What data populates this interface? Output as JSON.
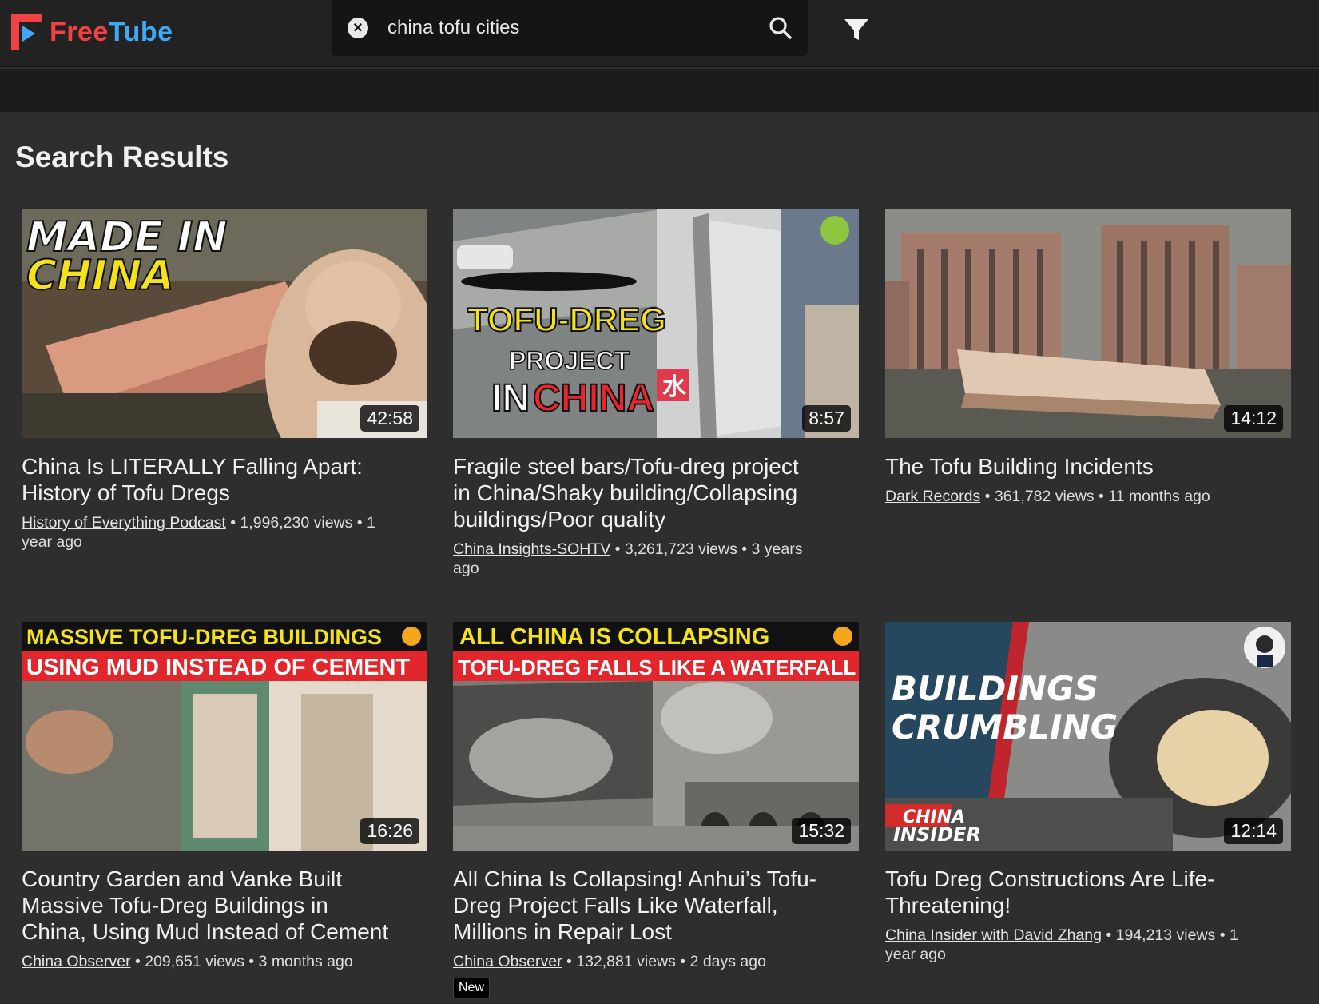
{
  "app": {
    "name_part1": "Free",
    "name_part2": "Tube",
    "brand_red": "#f04242",
    "brand_blue": "#3fa9f5"
  },
  "search": {
    "query": "china tofu cities",
    "clear_icon": "x-circle-icon",
    "search_icon": "magnifier-icon",
    "filter_icon": "funnel-icon"
  },
  "page": {
    "title": "Search Results"
  },
  "results": [
    {
      "title": "China Is LITERALLY Falling Apart: History of Tofu Dregs",
      "channel": "History of Everything Podcast",
      "stats": " • 1,996,230 views • 1 year ago",
      "duration": "42:58",
      "thumb_text": [
        "MADE IN",
        "CHINA"
      ]
    },
    {
      "title": "Fragile steel bars/Tofu-dreg project in China/Shaky building/Collapsing buildings/Poor quality",
      "channel": "China Insights-SOHTV",
      "stats": " • 3,261,723 views • 3 years ago",
      "duration": "8:57",
      "thumb_text": [
        "TOFU-DREG",
        "PROJECT",
        "IN",
        "CHINA",
        "水"
      ]
    },
    {
      "title": "The Tofu Building Incidents",
      "channel": "Dark Records",
      "stats": " • 361,782 views • 11 months ago",
      "duration": "14:12"
    },
    {
      "title": "Country Garden and Vanke Built Massive Tofu-Dreg Buildings in China, Using Mud Instead of Cement",
      "channel": "China Observer",
      "stats": " • 209,651 views • 3 months ago",
      "duration": "16:26",
      "thumb_text": [
        "MASSIVE TOFU-DREG BUILDINGS",
        "USING MUD INSTEAD OF CEMENT"
      ]
    },
    {
      "title": "All China Is Collapsing! Anhui’s Tofu-Dreg Project Falls Like Waterfall, Millions in Repair Lost",
      "channel": "China Observer",
      "stats": " • 132,881 views • 2 days ago",
      "duration": "15:32",
      "badge": "New",
      "thumb_text": [
        "ALL CHINA IS COLLAPSING",
        "TOFU-DREG FALLS LIKE A WATERFALL"
      ]
    },
    {
      "title": "Tofu Dreg Constructions Are Life-Threatening!",
      "channel": "China Insider with David Zhang",
      "stats": " • 194,213 views • 1 year ago",
      "duration": "12:14",
      "thumb_text": [
        "BUILDINGS",
        "CRUMBLING",
        "CHINA",
        "INSIDER"
      ]
    }
  ]
}
